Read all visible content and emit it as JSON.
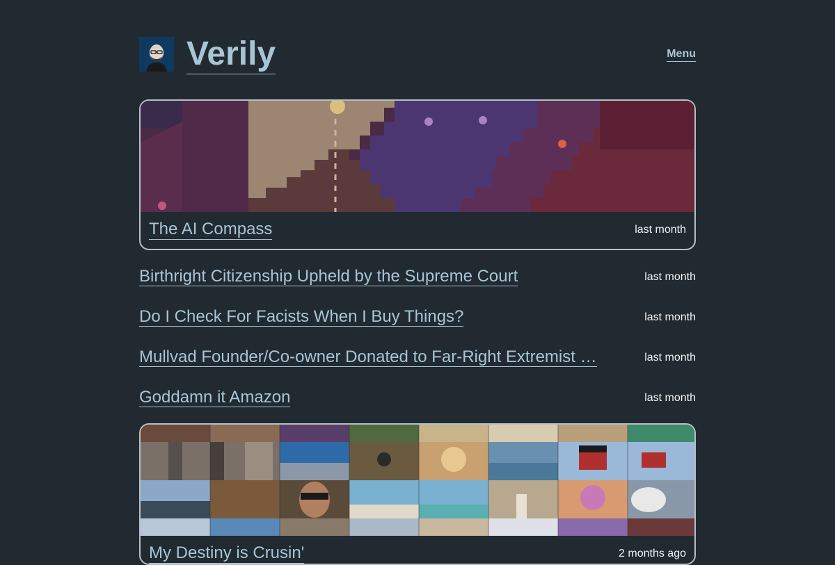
{
  "site": {
    "title": "Verily",
    "menu_label": "Menu"
  },
  "featured_posts": [
    {
      "title": "The AI Compass",
      "date": "last month"
    },
    {
      "title": "My Destiny is Crusin'",
      "date": "2 months ago"
    }
  ],
  "posts": [
    {
      "title": "Birthright Citizenship Upheld by the Supreme Court",
      "date": "last month"
    },
    {
      "title": "Do I Check For Facists When I Buy Things?",
      "date": "last month"
    },
    {
      "title": "Mullvad Founder/Co-owner Donated to Far-Right Extremist …",
      "date": "last month"
    },
    {
      "title": "Goddamn it Amazon",
      "date": "last month"
    }
  ],
  "colors": {
    "background": "#212a31",
    "link": "#a9c4d4",
    "text": "#f2f2f2"
  }
}
